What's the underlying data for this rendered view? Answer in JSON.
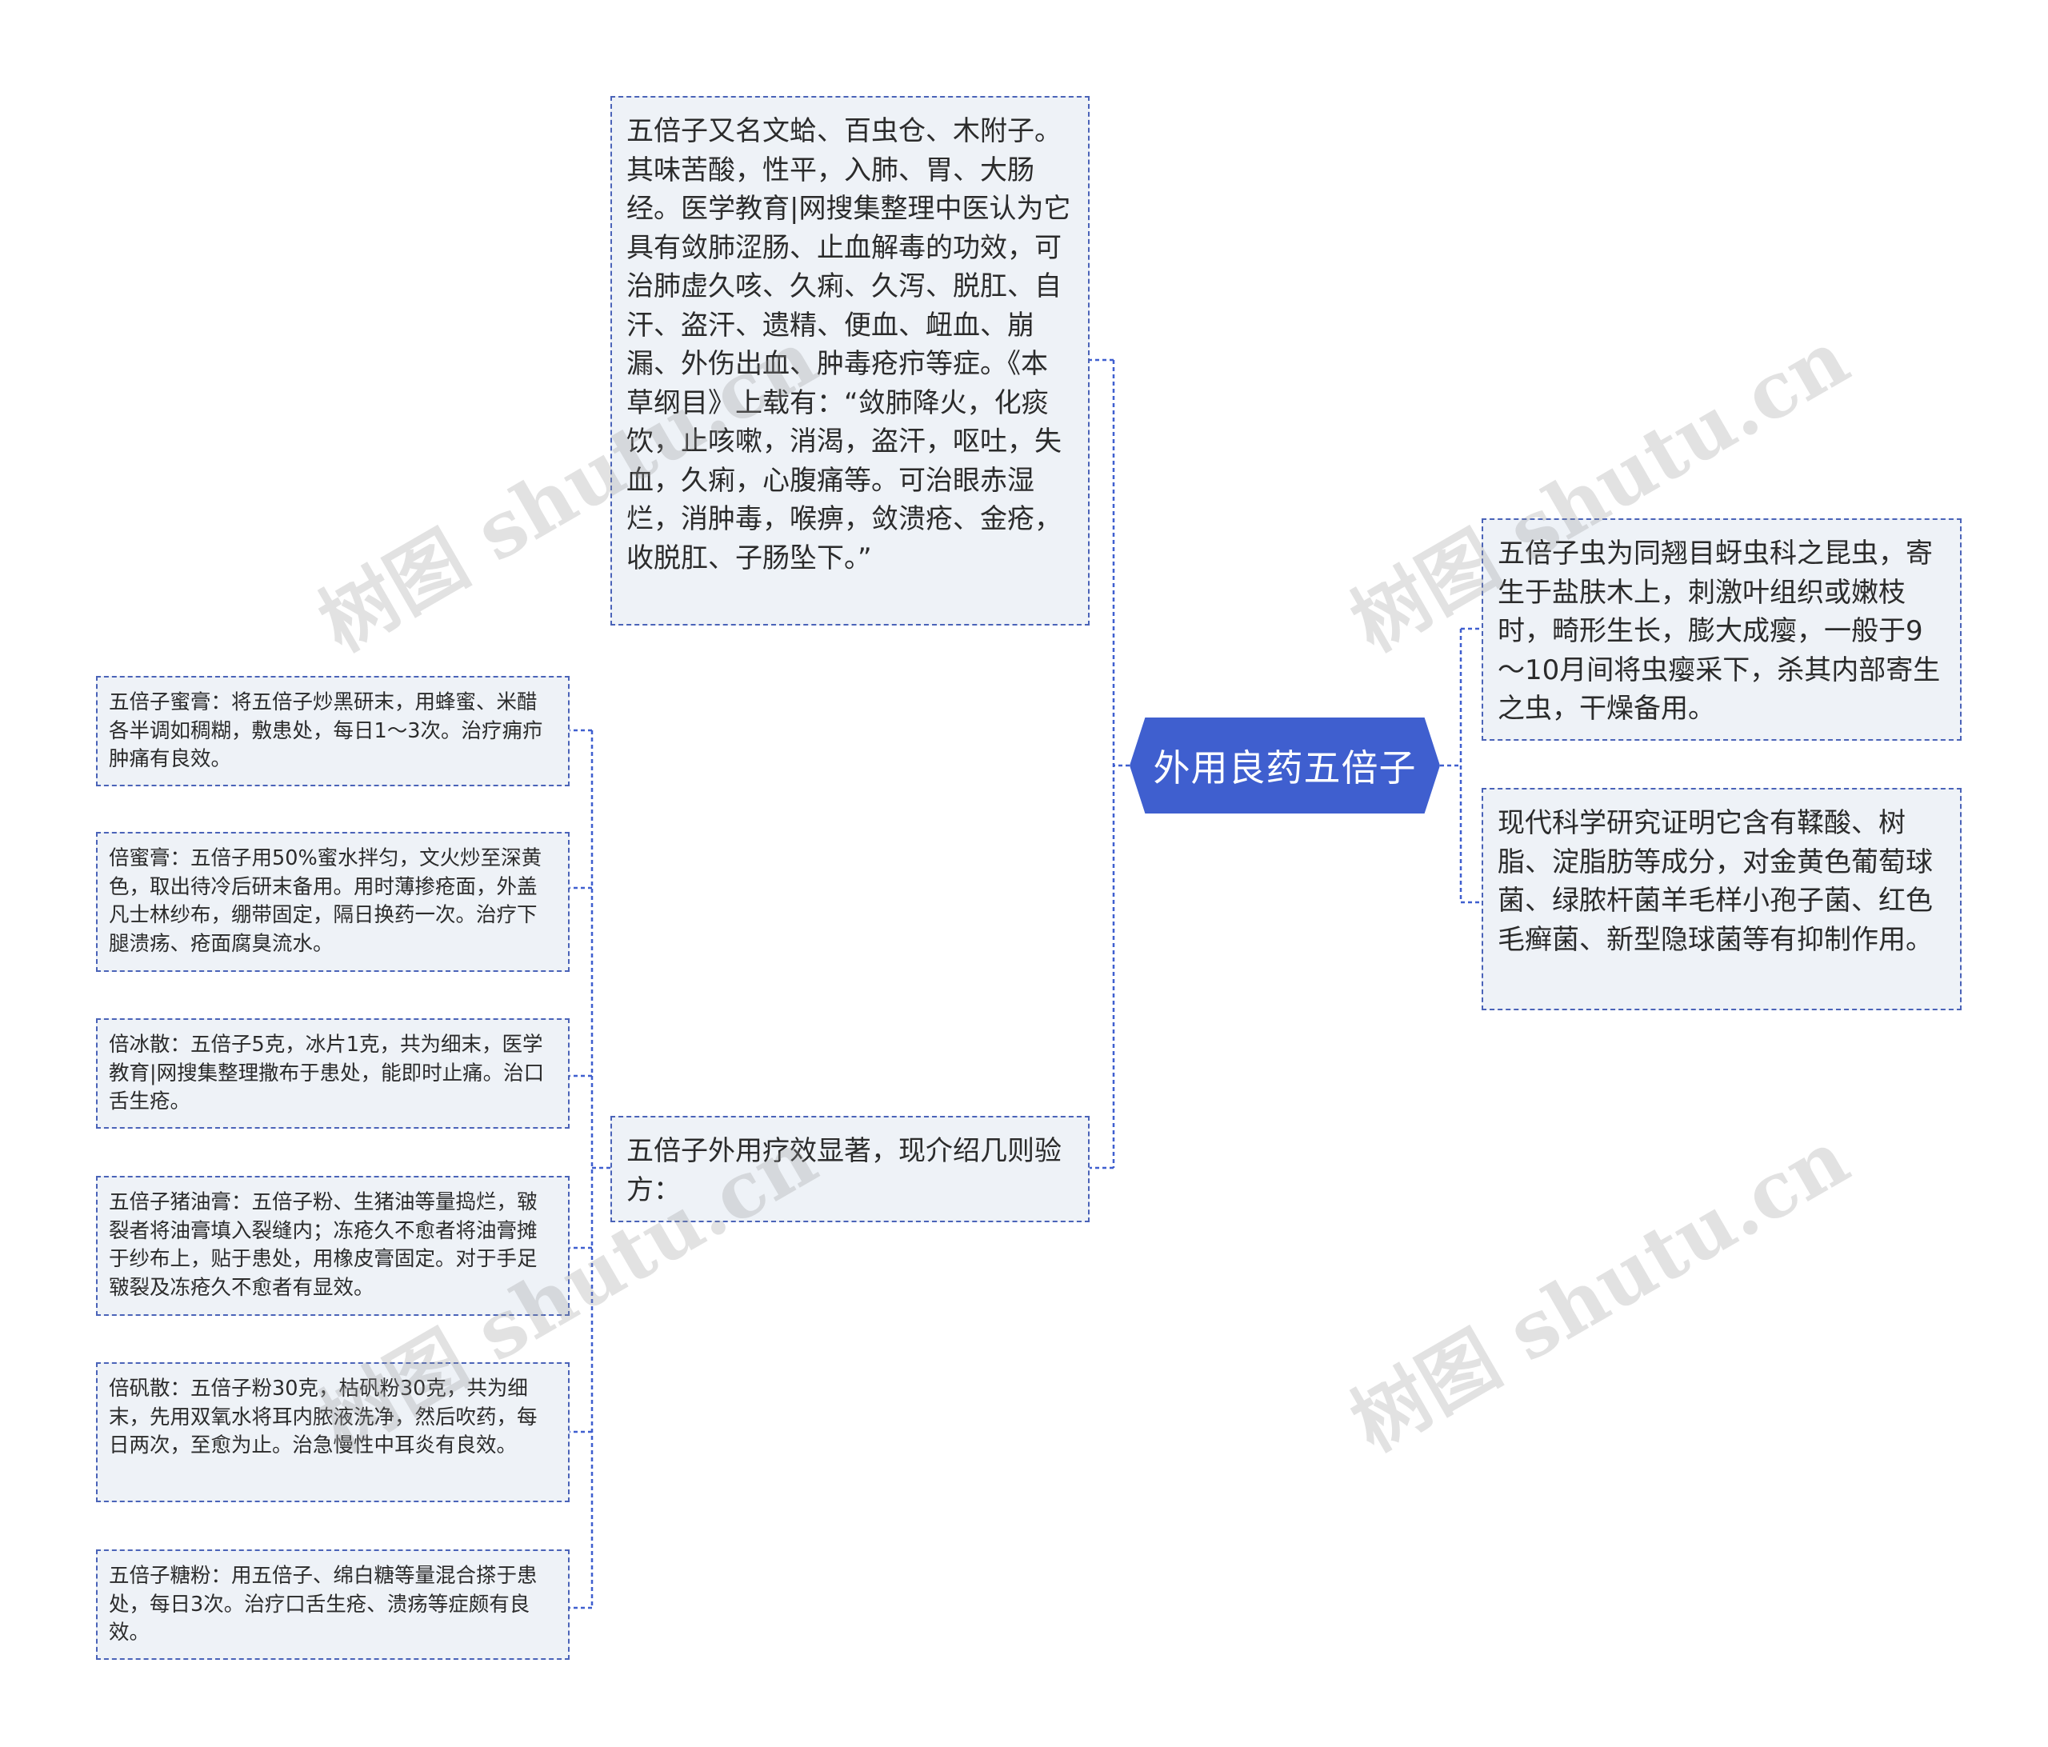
{
  "center": {
    "title": "外用良药五倍子"
  },
  "nodes": {
    "intro": "五倍子又名文蛤、百虫仓、木附子。其味苦酸，性平，入肺、胃、大肠经。医学教育|网搜集整理中医认为它具有敛肺涩肠、止血解毒的功效，可治肺虚久咳、久痢、久泻、脱肛、自汗、盗汗、遗精、便血、衄血、崩漏、外伤出血、肿毒疮疖等症。《本草纲目》上载有：“敛肺降火，化痰饮，止咳嗽，消渴，盗汗，呕吐，失血，久痢，心腹痛等。可治眼赤湿烂，消肿毒，喉痹，敛溃疮、金疮，收脱肛、子肠坠下。”",
    "prescriptions_intro": "五倍子外用疗效显著，现介绍几则验方：",
    "insect": "五倍子虫为同翘目蚜虫科之昆虫，寄生于盐肤木上，刺激叶组织或嫩枝时，畸形生长，膨大成瘿，一般于9～10月间将虫瘿采下，杀其内部寄生之虫，干燥备用。",
    "science": "现代科学研究证明它含有鞣酸、树脂、淀脂肪等成分，对金黄色葡萄球菌、绿脓杆菌羊毛样小孢子菌、红色毛癣菌、新型隐球菌等有抑制作用。"
  },
  "prescriptions": [
    "五倍子蜜膏：将五倍子炒黑研末，用蜂蜜、米醋各半调如稠糊，敷患处，每日1～3次。治疗痈疖肿痛有良效。",
    "倍蜜膏：五倍子用50%蜜水拌匀，文火炒至深黄色，取出待冷后研末备用。用时薄掺疮面，外盖凡士林纱布，绷带固定，隔日换药一次。治疗下腿溃疡、疮面腐臭流水。",
    "倍冰散：五倍子5克，冰片1克，共为细末，医学教育|网搜集整理撒布于患处，能即时止痛。治口舌生疮。",
    "五倍子猪油膏：五倍子粉、生猪油等量捣烂，皲裂者将油膏填入裂缝内；冻疮久不愈者将油膏摊于纱布上，贴于患处，用橡皮膏固定。对于手足皲裂及冻疮久不愈者有显效。",
    "倍矾散：五倍子粉30克，枯矾粉30克，共为细末，先用双氧水将耳内脓液洗净，然后吹药，每日两次，至愈为止。治急慢性中耳炎有良效。",
    "五倍子糖粉：用五倍子、绵白糖等量混合搽于患处，每日3次。治疗口舌生疮、溃疡等症颇有良效。"
  ],
  "watermark": "树图 shutu.cn",
  "colors": {
    "accent": "#3f5fcf",
    "node_bg": "#eef2f7",
    "border": "#4a63b8"
  }
}
